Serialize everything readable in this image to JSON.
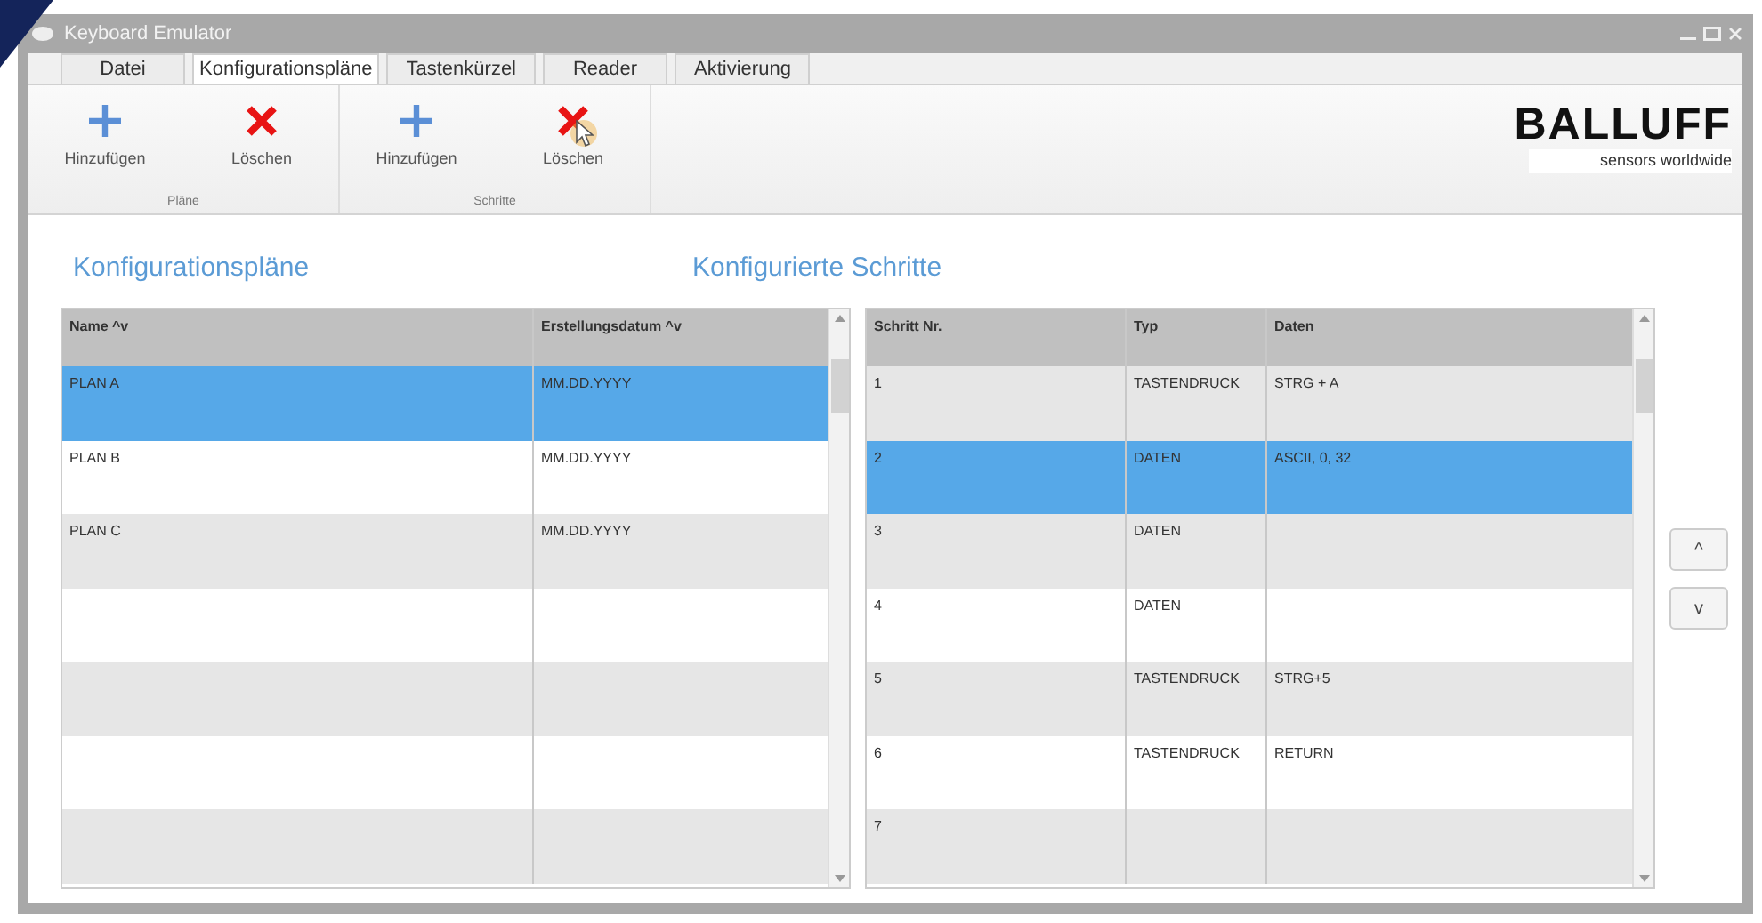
{
  "window": {
    "title": "Keyboard Emulator"
  },
  "menu_tabs": [
    {
      "label": "Datei",
      "selected": false
    },
    {
      "label": "Konfigurationspläne",
      "selected": true
    },
    {
      "label": "Tastenkürzel",
      "selected": false
    },
    {
      "label": "Reader",
      "selected": false
    },
    {
      "label": "Aktivierung",
      "selected": false
    }
  ],
  "ribbon_groups": [
    {
      "label": "Pläne",
      "buttons": [
        {
          "kind": "add",
          "label": "Hinzufügen",
          "hovered": false
        },
        {
          "kind": "delete",
          "label": "Löschen",
          "hovered": false
        }
      ]
    },
    {
      "label": "Schritte",
      "buttons": [
        {
          "kind": "add",
          "label": "Hinzufügen",
          "hovered": false
        },
        {
          "kind": "delete",
          "label": "Löschen",
          "hovered": true
        }
      ]
    }
  ],
  "logo": {
    "name": "BALLUFF",
    "tagline": "sensors worldwide"
  },
  "plans": {
    "title": "Konfigurationspläne",
    "columns": [
      "Name ^v",
      "Erstellungsdatum ^v"
    ],
    "rows": [
      {
        "name": "PLAN A",
        "date": "MM.DD.YYYY",
        "selected": true
      },
      {
        "name": "PLAN B",
        "date": "MM.DD.YYYY",
        "selected": false
      },
      {
        "name": "PLAN C",
        "date": "MM.DD.YYYY",
        "selected": false
      }
    ]
  },
  "steps": {
    "title": "Konfigurierte Schritte",
    "columns": [
      "Schritt Nr.",
      "Typ",
      "Daten"
    ],
    "rows": [
      {
        "nr": "1",
        "typ": "TASTENDRUCK",
        "daten": "STRG + A",
        "selected": false
      },
      {
        "nr": "2",
        "typ": "DATEN",
        "daten": "ASCII, 0, 32",
        "selected": true
      },
      {
        "nr": "3",
        "typ": "DATEN",
        "selected": false
      },
      {
        "nr": "4",
        "typ": "DATEN",
        "selected": false
      },
      {
        "nr": "5",
        "typ": "TASTENDRUCK",
        "daten": "STRG+5",
        "selected": false
      },
      {
        "nr": "6",
        "typ": "TASTENDRUCK",
        "daten": "RETURN",
        "selected": false
      },
      {
        "nr": "7",
        "selected": false
      }
    ]
  },
  "move_buttons": [
    {
      "label": "^"
    },
    {
      "label": "v"
    }
  ]
}
